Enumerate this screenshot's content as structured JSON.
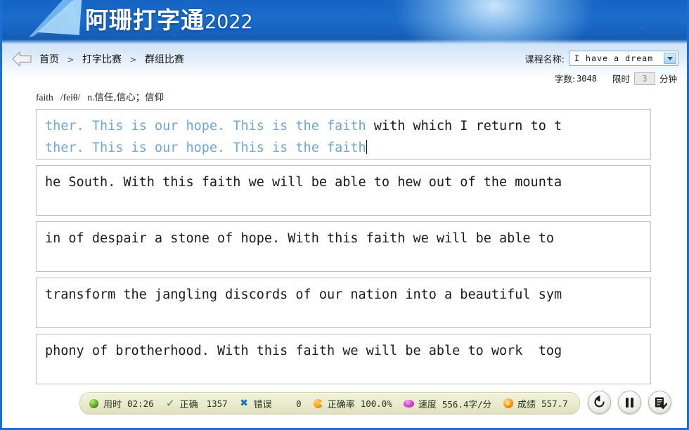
{
  "banner": {
    "title_cn": "阿珊打字通",
    "title_year": "2022",
    "logo": "paper-plane-logo"
  },
  "nav": {
    "back_icon": "back-arrow-icon",
    "breadcrumb": [
      "首页",
      "打字比赛",
      "群组比赛"
    ],
    "separator": ">"
  },
  "course": {
    "label": "课程名称:",
    "selected": "I have a dream",
    "dropdown_icon": "chevron-down-icon"
  },
  "meta": {
    "wordcount_label": "字数:",
    "wordcount_value": "3048",
    "limit_label": "限时",
    "limit_value": "3",
    "limit_unit": "分钟"
  },
  "hint": {
    "word": "faith",
    "phonetic": "/feiθ/",
    "pos": "n.",
    "meaning": "信任,信心；信仰"
  },
  "boxes": [
    {
      "ref_done": "ther. This is our hope. This is the faith",
      "ref_todo": " with which I return to t",
      "typed": "ther. This is our hope. This is the faith",
      "has_caret": true
    },
    {
      "ref_done": "",
      "ref_todo": "he South. With this faith we will be able to hew out of the mounta",
      "typed": "",
      "has_caret": false
    },
    {
      "ref_done": "",
      "ref_todo": "in of despair a stone of hope. With this faith we will be able to",
      "typed": "",
      "has_caret": false
    },
    {
      "ref_done": "",
      "ref_todo": "transform the jangling discords of our nation into a beautiful sym",
      "typed": "",
      "has_caret": false
    },
    {
      "ref_done": "",
      "ref_todo": "phony of brotherhood. With this faith we will be able to work  tog",
      "typed": "",
      "has_caret": false
    }
  ],
  "status": {
    "items": [
      {
        "icon": "clock-icon",
        "label": "用时",
        "value": "02:26"
      },
      {
        "icon": "check-icon",
        "label": "正确",
        "value": "1357"
      },
      {
        "icon": "cross-icon",
        "label": "错误",
        "value": "0"
      },
      {
        "icon": "pie-chart-icon",
        "label": "正确率",
        "value": "100.0%"
      },
      {
        "icon": "speed-icon",
        "label": "速度",
        "value": "556.4字/分"
      },
      {
        "icon": "star-icon",
        "label": "成绩",
        "value": "557.7"
      }
    ]
  },
  "controls": [
    {
      "name": "restart-button",
      "icon": "restart-icon"
    },
    {
      "name": "pause-button",
      "icon": "pause-icon"
    },
    {
      "name": "report-button",
      "icon": "report-icon"
    }
  ],
  "colors": {
    "banner_blue": "#1664c4",
    "frame_blue": "#1a6fd4",
    "typed_text": "#6fa6d6",
    "pending_text": "#1a1a1a",
    "statusbar_bg": "#eaeacd"
  }
}
